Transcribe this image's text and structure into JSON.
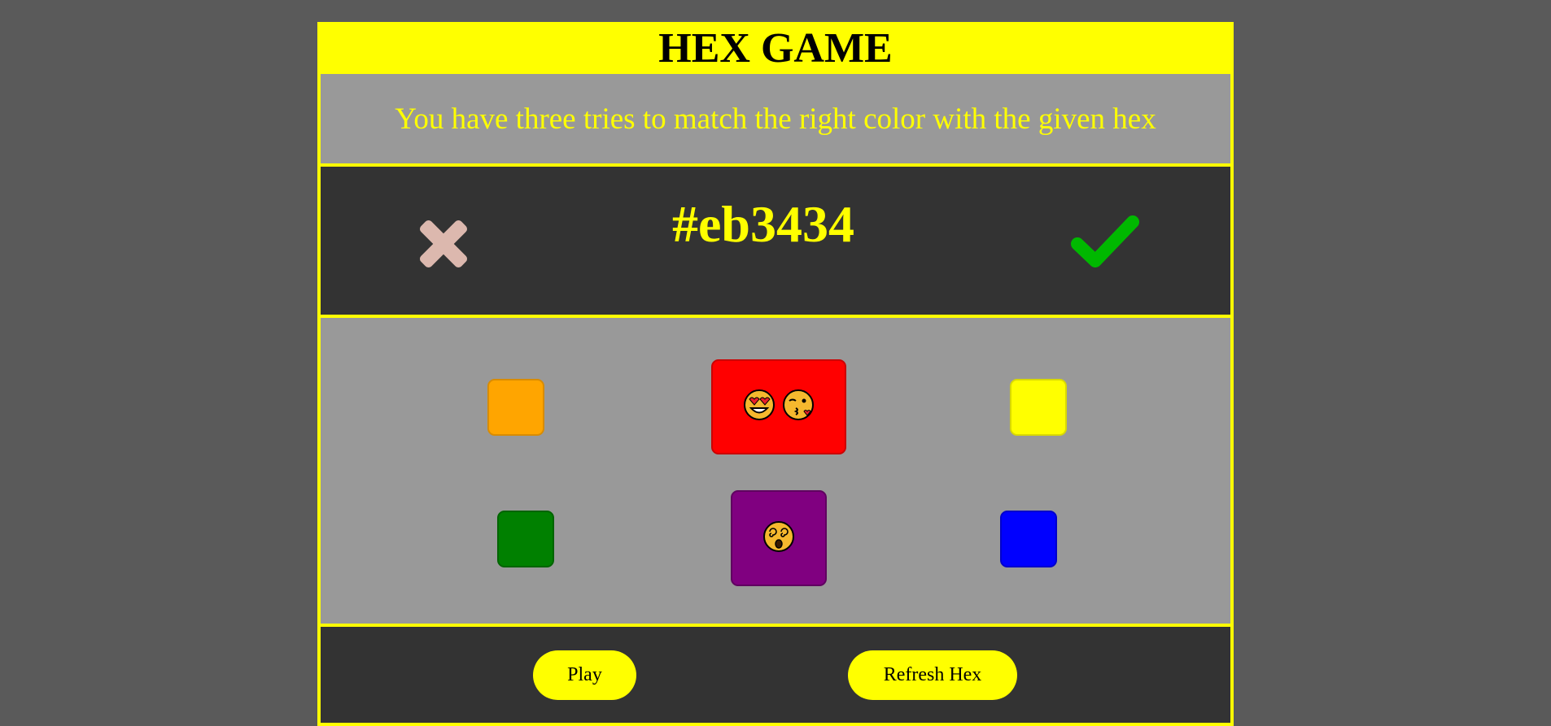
{
  "header": {
    "title": "HEX GAME"
  },
  "instructions": {
    "text": "You have three tries to match the right color with the given hex"
  },
  "status": {
    "hex": "#eb3434",
    "wrong_icon": "x-icon",
    "right_icon": "check-icon",
    "wrong_color": "#dcb8ae",
    "right_color": "#00b800"
  },
  "swatches": [
    {
      "color_name": "orange",
      "color": "#ffa500",
      "border": "#d98c00",
      "emojis": []
    },
    {
      "color_name": "red",
      "color": "#ff0000",
      "border": "#cc0000",
      "emojis": [
        "smiling-face-with-heart-eyes",
        "face-blowing-a-kiss"
      ]
    },
    {
      "color_name": "yellow",
      "color": "#ffff00",
      "border": "#d9d900",
      "emojis": []
    },
    {
      "color_name": "green",
      "color": "#008000",
      "border": "#006400",
      "emojis": []
    },
    {
      "color_name": "purple",
      "color": "#800080",
      "border": "#600060",
      "emojis": [
        "face-with-spiral-eyes"
      ]
    },
    {
      "color_name": "blue",
      "color": "#0000ff",
      "border": "#0000cc",
      "emojis": []
    }
  ],
  "controls": {
    "play_label": "Play",
    "refresh_label": "Refresh Hex"
  },
  "colors": {
    "background": "#5a5a5a",
    "accent": "#ffff00",
    "panel_dark": "#333333",
    "panel_gray": "#999999"
  }
}
